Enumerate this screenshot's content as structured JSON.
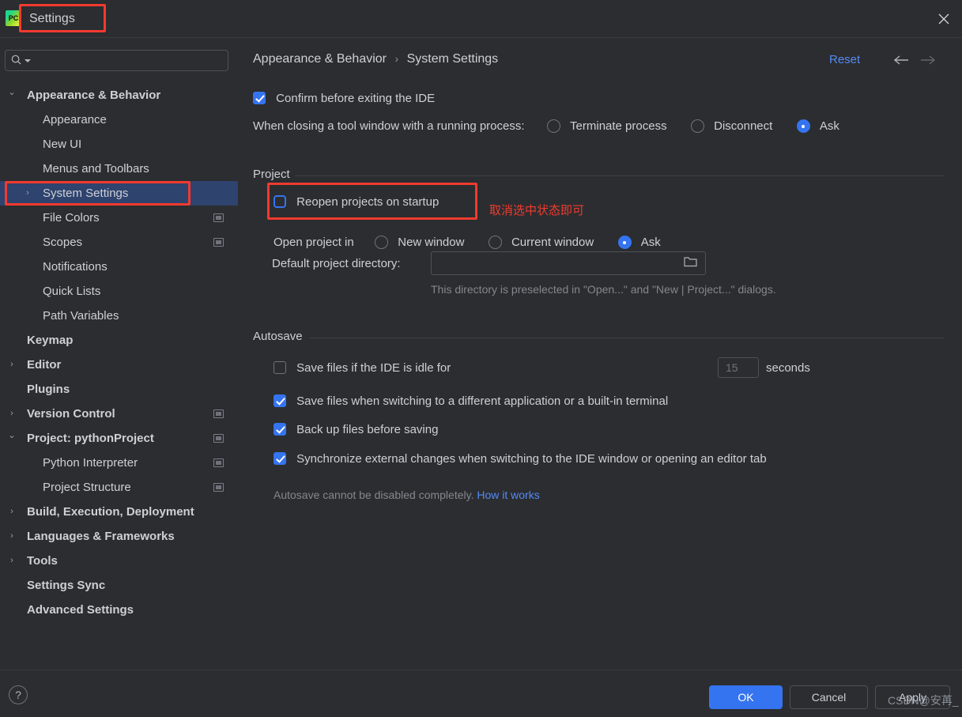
{
  "window": {
    "title": "Settings",
    "app_icon": "pycharm-icon",
    "close_icon": "close-icon"
  },
  "sidebar": {
    "search": {
      "placeholder": "",
      "value": "",
      "icon": "search-icon",
      "dropdown_icon": "chevron-down-icon"
    },
    "items": [
      {
        "label": "Appearance & Behavior",
        "level": 0,
        "arrow": "expanded",
        "badge": false,
        "selected": false
      },
      {
        "label": "Appearance",
        "level": 1,
        "arrow": "none",
        "badge": false,
        "selected": false
      },
      {
        "label": "New UI",
        "level": 1,
        "arrow": "none",
        "badge": false,
        "selected": false
      },
      {
        "label": "Menus and Toolbars",
        "level": 1,
        "arrow": "none",
        "badge": false,
        "selected": false
      },
      {
        "label": "System Settings",
        "level": 1,
        "arrow": "collapsed",
        "badge": false,
        "selected": true
      },
      {
        "label": "File Colors",
        "level": 1,
        "arrow": "none",
        "badge": true,
        "selected": false
      },
      {
        "label": "Scopes",
        "level": 1,
        "arrow": "none",
        "badge": true,
        "selected": false
      },
      {
        "label": "Notifications",
        "level": 1,
        "arrow": "none",
        "badge": false,
        "selected": false
      },
      {
        "label": "Quick Lists",
        "level": 1,
        "arrow": "none",
        "badge": false,
        "selected": false
      },
      {
        "label": "Path Variables",
        "level": 1,
        "arrow": "none",
        "badge": false,
        "selected": false
      },
      {
        "label": "Keymap",
        "level": 0,
        "arrow": "none",
        "badge": false,
        "selected": false
      },
      {
        "label": "Editor",
        "level": 0,
        "arrow": "collapsed",
        "badge": false,
        "selected": false
      },
      {
        "label": "Plugins",
        "level": 0,
        "arrow": "none",
        "badge": false,
        "selected": false
      },
      {
        "label": "Version Control",
        "level": 0,
        "arrow": "collapsed",
        "badge": true,
        "selected": false
      },
      {
        "label": "Project: pythonProject",
        "level": 0,
        "arrow": "expanded",
        "badge": true,
        "selected": false
      },
      {
        "label": "Python Interpreter",
        "level": 1,
        "arrow": "none",
        "badge": true,
        "selected": false
      },
      {
        "label": "Project Structure",
        "level": 1,
        "arrow": "none",
        "badge": true,
        "selected": false
      },
      {
        "label": "Build, Execution, Deployment",
        "level": 0,
        "arrow": "collapsed",
        "badge": false,
        "selected": false
      },
      {
        "label": "Languages & Frameworks",
        "level": 0,
        "arrow": "collapsed",
        "badge": false,
        "selected": false
      },
      {
        "label": "Tools",
        "level": 0,
        "arrow": "collapsed",
        "badge": false,
        "selected": false
      },
      {
        "label": "Settings Sync",
        "level": 0,
        "arrow": "none",
        "badge": false,
        "selected": false
      },
      {
        "label": "Advanced Settings",
        "level": 0,
        "arrow": "none",
        "badge": false,
        "selected": false
      }
    ]
  },
  "main": {
    "breadcrumb": {
      "parent": "Appearance & Behavior",
      "separator": "›",
      "current": "System Settings"
    },
    "reset_label": "Reset",
    "nav_back_icon": "arrow-left-icon",
    "nav_forward_icon": "arrow-right-icon",
    "confirm_exit": {
      "label": "Confirm before exiting the IDE",
      "checked": true
    },
    "tool_window": {
      "label": "When closing a tool window with a running process:",
      "options": [
        {
          "label": "Terminate process",
          "selected": false
        },
        {
          "label": "Disconnect",
          "selected": false
        },
        {
          "label": "Ask",
          "selected": true
        }
      ]
    },
    "project_group": {
      "title": "Project",
      "reopen": {
        "label": "Reopen projects on startup",
        "checked": false,
        "focused": true
      },
      "open_project_in": {
        "label": "Open project in",
        "options": [
          {
            "label": "New window",
            "selected": false
          },
          {
            "label": "Current window",
            "selected": false
          },
          {
            "label": "Ask",
            "selected": true
          }
        ]
      },
      "default_dir": {
        "label": "Default project directory:",
        "value": "",
        "placeholder": "",
        "browse_icon": "folder-icon"
      },
      "hint": "This directory is preselected in \"Open...\" and \"New | Project...\" dialogs."
    },
    "autosave_group": {
      "title": "Autosave",
      "idle": {
        "label_before": "Save files if the IDE is idle for",
        "label_after": "seconds",
        "checked": false,
        "value": "15"
      },
      "checkboxes": [
        {
          "label": "Save files when switching to a different application or a built-in terminal",
          "checked": true
        },
        {
          "label": "Back up files before saving",
          "checked": true
        },
        {
          "label": "Synchronize external changes when switching to the IDE window or opening an editor tab",
          "checked": true
        }
      ],
      "footnote": "Autosave cannot be disabled completely.",
      "footnote_link": "How it works"
    },
    "annotation": "取消选中状态即可"
  },
  "footer": {
    "help_label": "?",
    "ok_label": "OK",
    "cancel_label": "Cancel",
    "apply_label": "Apply"
  },
  "watermark": "CSDN@安苒_",
  "colors": {
    "background": "#2b2d30",
    "accent": "#3574f0",
    "link": "#548af7",
    "selection": "#2e436e",
    "annotation_red": "#f23a2f"
  }
}
